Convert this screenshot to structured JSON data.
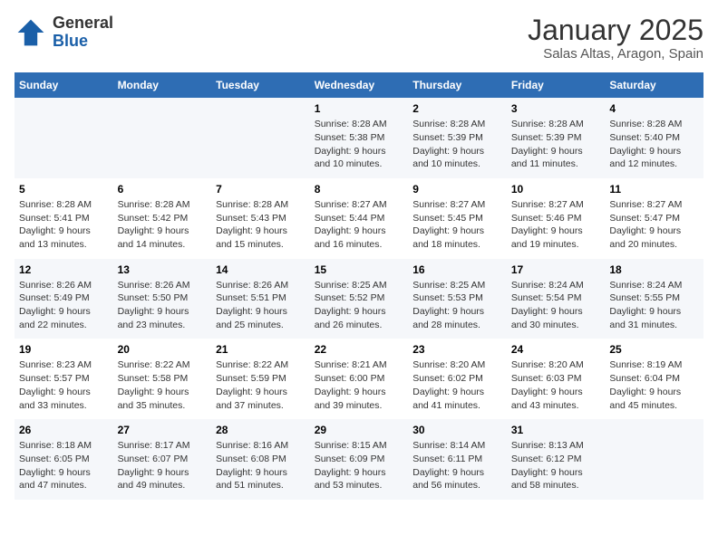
{
  "logo": {
    "general": "General",
    "blue": "Blue"
  },
  "title": "January 2025",
  "subtitle": "Salas Altas, Aragon, Spain",
  "days_of_week": [
    "Sunday",
    "Monday",
    "Tuesday",
    "Wednesday",
    "Thursday",
    "Friday",
    "Saturday"
  ],
  "weeks": [
    [
      {
        "day": "",
        "info": ""
      },
      {
        "day": "",
        "info": ""
      },
      {
        "day": "",
        "info": ""
      },
      {
        "day": "1",
        "info": "Sunrise: 8:28 AM\nSunset: 5:38 PM\nDaylight: 9 hours and 10 minutes."
      },
      {
        "day": "2",
        "info": "Sunrise: 8:28 AM\nSunset: 5:39 PM\nDaylight: 9 hours and 10 minutes."
      },
      {
        "day": "3",
        "info": "Sunrise: 8:28 AM\nSunset: 5:39 PM\nDaylight: 9 hours and 11 minutes."
      },
      {
        "day": "4",
        "info": "Sunrise: 8:28 AM\nSunset: 5:40 PM\nDaylight: 9 hours and 12 minutes."
      }
    ],
    [
      {
        "day": "5",
        "info": "Sunrise: 8:28 AM\nSunset: 5:41 PM\nDaylight: 9 hours and 13 minutes."
      },
      {
        "day": "6",
        "info": "Sunrise: 8:28 AM\nSunset: 5:42 PM\nDaylight: 9 hours and 14 minutes."
      },
      {
        "day": "7",
        "info": "Sunrise: 8:28 AM\nSunset: 5:43 PM\nDaylight: 9 hours and 15 minutes."
      },
      {
        "day": "8",
        "info": "Sunrise: 8:27 AM\nSunset: 5:44 PM\nDaylight: 9 hours and 16 minutes."
      },
      {
        "day": "9",
        "info": "Sunrise: 8:27 AM\nSunset: 5:45 PM\nDaylight: 9 hours and 18 minutes."
      },
      {
        "day": "10",
        "info": "Sunrise: 8:27 AM\nSunset: 5:46 PM\nDaylight: 9 hours and 19 minutes."
      },
      {
        "day": "11",
        "info": "Sunrise: 8:27 AM\nSunset: 5:47 PM\nDaylight: 9 hours and 20 minutes."
      }
    ],
    [
      {
        "day": "12",
        "info": "Sunrise: 8:26 AM\nSunset: 5:49 PM\nDaylight: 9 hours and 22 minutes."
      },
      {
        "day": "13",
        "info": "Sunrise: 8:26 AM\nSunset: 5:50 PM\nDaylight: 9 hours and 23 minutes."
      },
      {
        "day": "14",
        "info": "Sunrise: 8:26 AM\nSunset: 5:51 PM\nDaylight: 9 hours and 25 minutes."
      },
      {
        "day": "15",
        "info": "Sunrise: 8:25 AM\nSunset: 5:52 PM\nDaylight: 9 hours and 26 minutes."
      },
      {
        "day": "16",
        "info": "Sunrise: 8:25 AM\nSunset: 5:53 PM\nDaylight: 9 hours and 28 minutes."
      },
      {
        "day": "17",
        "info": "Sunrise: 8:24 AM\nSunset: 5:54 PM\nDaylight: 9 hours and 30 minutes."
      },
      {
        "day": "18",
        "info": "Sunrise: 8:24 AM\nSunset: 5:55 PM\nDaylight: 9 hours and 31 minutes."
      }
    ],
    [
      {
        "day": "19",
        "info": "Sunrise: 8:23 AM\nSunset: 5:57 PM\nDaylight: 9 hours and 33 minutes."
      },
      {
        "day": "20",
        "info": "Sunrise: 8:22 AM\nSunset: 5:58 PM\nDaylight: 9 hours and 35 minutes."
      },
      {
        "day": "21",
        "info": "Sunrise: 8:22 AM\nSunset: 5:59 PM\nDaylight: 9 hours and 37 minutes."
      },
      {
        "day": "22",
        "info": "Sunrise: 8:21 AM\nSunset: 6:00 PM\nDaylight: 9 hours and 39 minutes."
      },
      {
        "day": "23",
        "info": "Sunrise: 8:20 AM\nSunset: 6:02 PM\nDaylight: 9 hours and 41 minutes."
      },
      {
        "day": "24",
        "info": "Sunrise: 8:20 AM\nSunset: 6:03 PM\nDaylight: 9 hours and 43 minutes."
      },
      {
        "day": "25",
        "info": "Sunrise: 8:19 AM\nSunset: 6:04 PM\nDaylight: 9 hours and 45 minutes."
      }
    ],
    [
      {
        "day": "26",
        "info": "Sunrise: 8:18 AM\nSunset: 6:05 PM\nDaylight: 9 hours and 47 minutes."
      },
      {
        "day": "27",
        "info": "Sunrise: 8:17 AM\nSunset: 6:07 PM\nDaylight: 9 hours and 49 minutes."
      },
      {
        "day": "28",
        "info": "Sunrise: 8:16 AM\nSunset: 6:08 PM\nDaylight: 9 hours and 51 minutes."
      },
      {
        "day": "29",
        "info": "Sunrise: 8:15 AM\nSunset: 6:09 PM\nDaylight: 9 hours and 53 minutes."
      },
      {
        "day": "30",
        "info": "Sunrise: 8:14 AM\nSunset: 6:11 PM\nDaylight: 9 hours and 56 minutes."
      },
      {
        "day": "31",
        "info": "Sunrise: 8:13 AM\nSunset: 6:12 PM\nDaylight: 9 hours and 58 minutes."
      },
      {
        "day": "",
        "info": ""
      }
    ]
  ]
}
